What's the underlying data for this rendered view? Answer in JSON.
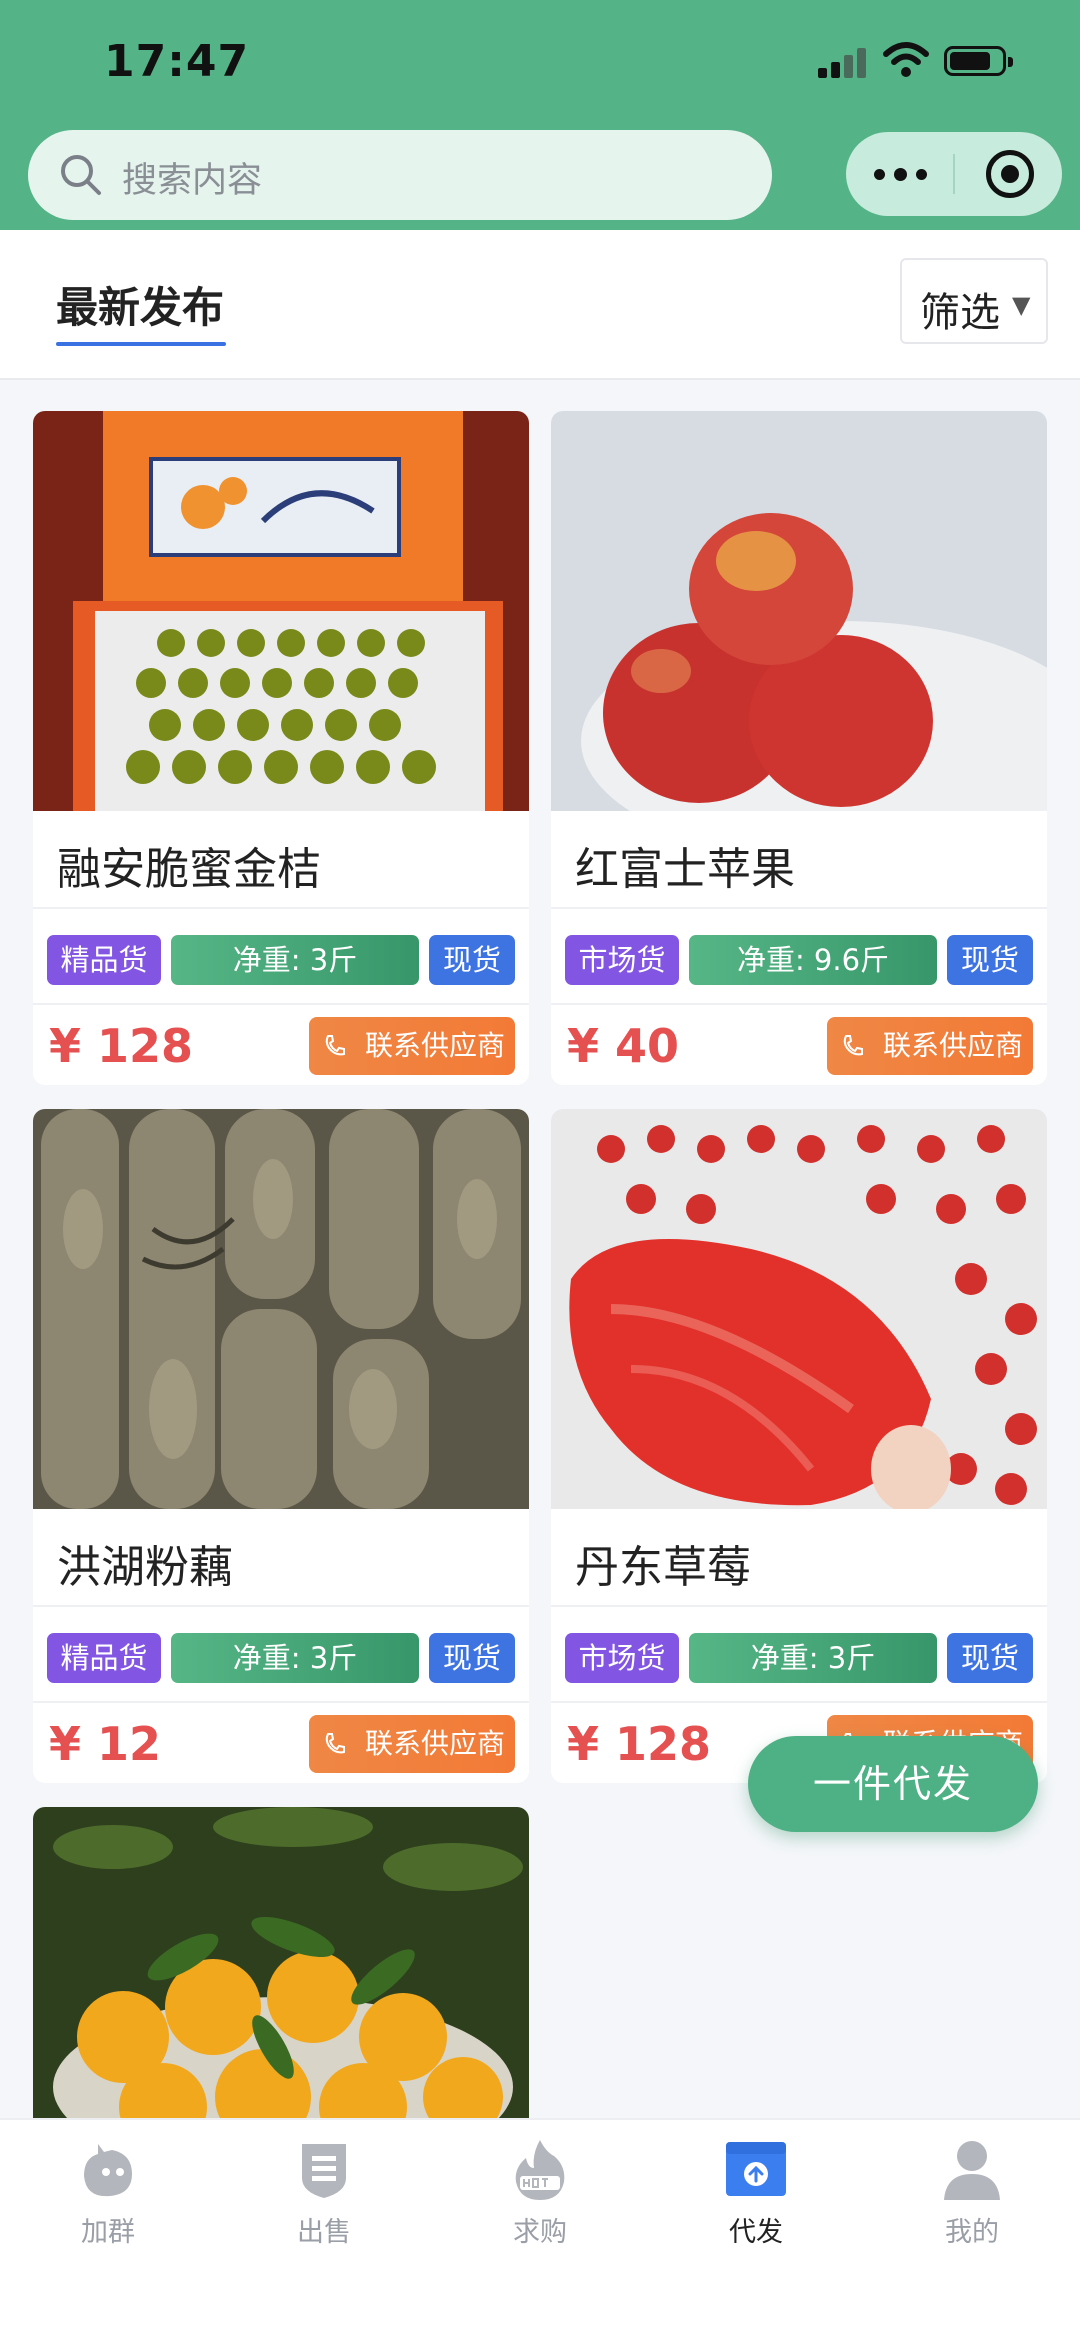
{
  "status_bar": {
    "time": "17:47"
  },
  "search": {
    "placeholder": "搜索内容"
  },
  "tabs": {
    "active_label": "最新发布",
    "filter_label": "筛选",
    "filter_arrow": "▼"
  },
  "products": [
    {
      "name": "融安脆蜜金桔",
      "grade": "精品货",
      "weight": "净重: 3斤",
      "stock": "现货",
      "price": "¥ 128",
      "contact": "联系供应商",
      "image": "kumquat-gift-box"
    },
    {
      "name": "红富士苹果",
      "grade": "市场货",
      "weight": "净重: 9.6斤",
      "stock": "现货",
      "price": "¥ 40",
      "contact": "联系供应商",
      "image": "red-apples"
    },
    {
      "name": "洪湖粉藕",
      "grade": "精品货",
      "weight": "净重: 3斤",
      "stock": "现货",
      "price": "¥ 12",
      "contact": "联系供应商",
      "image": "lotus-roots"
    },
    {
      "name": "丹东草莓",
      "grade": "市场货",
      "weight": "净重: 3斤",
      "stock": "现货",
      "price": "¥ 128",
      "contact": "联系供应商",
      "image": "strawberries"
    },
    {
      "image": "oranges-on-tree"
    }
  ],
  "fab": {
    "label": "一件代发"
  },
  "bottom_nav": [
    {
      "label": "加群",
      "icon": "chat-bird-icon"
    },
    {
      "label": "出售",
      "icon": "sell-shield-icon"
    },
    {
      "label": "求购",
      "icon": "hot-flame-icon"
    },
    {
      "label": "代发",
      "icon": "upload-box-icon",
      "active": true
    },
    {
      "label": "我的",
      "icon": "person-icon"
    }
  ],
  "colors": {
    "header_green": "#54b387",
    "grade_purple": "#8355e3",
    "weight_green": "#45a677",
    "stock_blue": "#3e73e2",
    "price_red": "#e55050",
    "contact_orange": "#f08745",
    "active_blue": "#3a7ef0"
  }
}
